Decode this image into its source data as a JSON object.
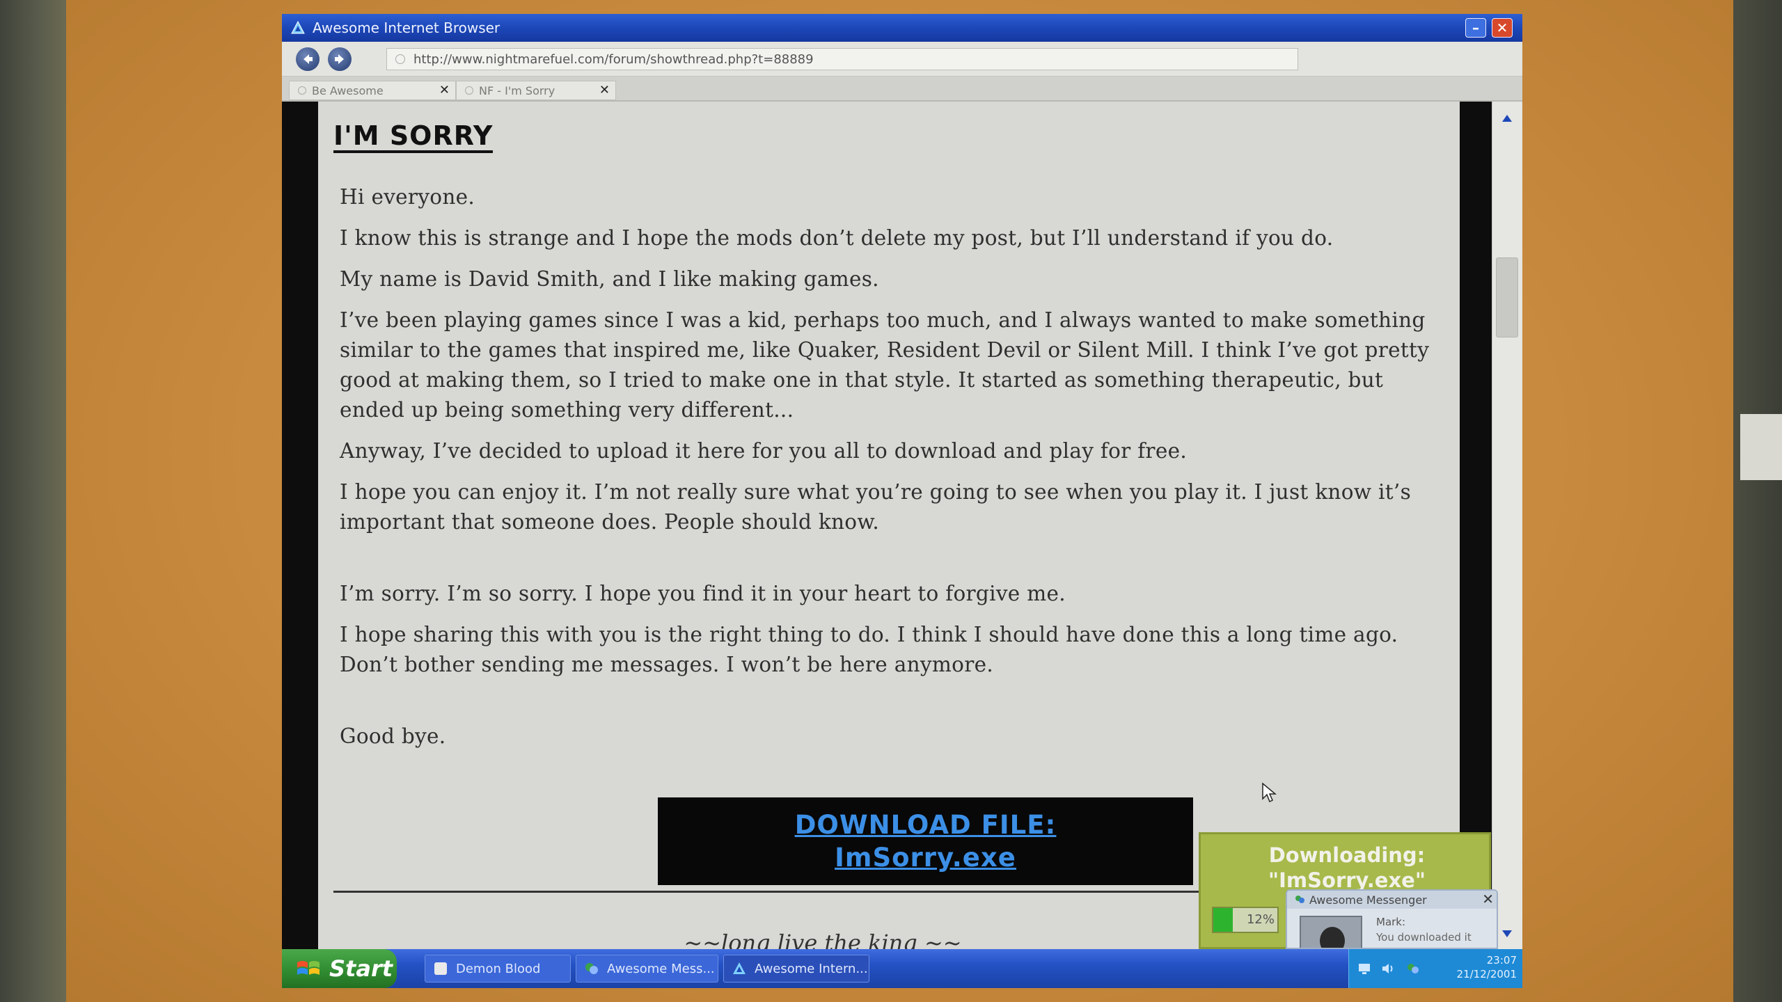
{
  "browser": {
    "title": "Awesome Internet Browser",
    "url": "http://www.nightmarefuel.com/forum/showthread.php?t=88889",
    "tabs": [
      {
        "label": "Be Awesome"
      },
      {
        "label": "NF - I'm Sorry"
      }
    ],
    "min_glyph": "–",
    "close_glyph": "✕",
    "tab_close_glyph": "✕"
  },
  "post": {
    "title": "I'M SORRY",
    "paragraphs": [
      "Hi everyone.",
      "I know this is strange and I hope the mods don’t delete my post, but I’ll understand if you do.",
      "My name is David Smith, and I like making games.",
      "I’ve been playing games since I was a kid, perhaps too much, and I always wanted to make something similar to the games that inspired me, like Quaker, Resident Devil or Silent Mill. I think I’ve got pretty good at making them, so I tried to make one in that style. It started as something therapeutic, but ended up being something very different...",
      "Anyway, I’ve decided to upload it here for you all to download and play for free.",
      "I hope you can enjoy it. I’m not really sure what you’re going to see when you play it. I just know it’s important that someone does. People should know.",
      "I’m sorry. I’m so sorry. I hope you find it in your heart to forgive me.",
      "I hope sharing this with you is the right thing to do. I think I should have done this a long time ago. Don’t bother sending me messages. I won’t be here anymore.",
      "Good bye."
    ],
    "download_line1": "DOWNLOAD FILE:",
    "download_line2": "ImSorry.exe",
    "signature": "~~long live the king ~~"
  },
  "download_popup": {
    "line1": "Downloading:",
    "line2": "\"ImSorry.exe\"",
    "percent_label": "12%",
    "progress": 0.12
  },
  "messenger": {
    "title": "Awesome Messenger",
    "from": "Mark:",
    "preview": "You downloaded it",
    "close_glyph": "✕"
  },
  "taskbar": {
    "start_label": "Start",
    "tasks": [
      {
        "label": "Demon Blood"
      },
      {
        "label": "Awesome Mess..."
      },
      {
        "label": "Awesome Intern..."
      }
    ],
    "time": "23:07",
    "date": "21/12/2001"
  },
  "colors": {
    "titlebar": "#1c47b8",
    "link": "#3c8fe6",
    "start": "#2f8a2f",
    "popup": "#a7b94a",
    "progress": "#2eb32e"
  },
  "icons": {
    "app": "browser-logo-icon",
    "back": "arrow-left-icon",
    "forward": "arrow-right-icon",
    "start": "windows-flag-icon",
    "messenger": "messenger-icon"
  }
}
